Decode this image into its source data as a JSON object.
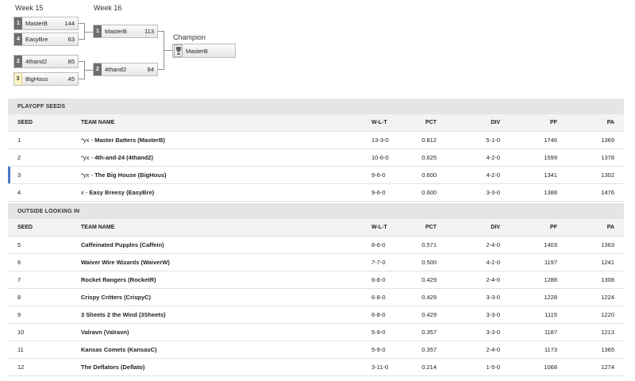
{
  "bracket": {
    "week15_label": "Week 15",
    "week16_label": "Week 16",
    "champion_label": "Champion",
    "week15": [
      {
        "seed": "1",
        "team": "MasterB",
        "score": "144",
        "highlight": false
      },
      {
        "seed": "4",
        "team": "EasyBre",
        "score": "63",
        "highlight": false
      },
      {
        "seed": "2",
        "team": "4thand2",
        "score": "85",
        "highlight": false
      },
      {
        "seed": "3",
        "team": "BigHous",
        "score": "45",
        "highlight": true
      }
    ],
    "week16": [
      {
        "seed": "1",
        "team": "MasterB",
        "score": "113"
      },
      {
        "seed": "2",
        "team": "4thand2",
        "score": "84"
      }
    ],
    "champion": {
      "team": "MasterB",
      "icon": "trophy-icon"
    }
  },
  "playoff": {
    "title": "PLAYOFF SEEDS",
    "headers": {
      "seed": "SEED",
      "team": "TEAM NAME",
      "wlt": "W-L-T",
      "pct": "PCT",
      "div": "DIV",
      "pf": "PF",
      "pa": "PA"
    },
    "rows": [
      {
        "seed": "1",
        "prefix": "*yx - ",
        "name": "Master Batters (MasterB)",
        "wlt": "13-3-0",
        "pct": "0.812",
        "div": "5-1-0",
        "pf": "1746",
        "pa": "1369"
      },
      {
        "seed": "2",
        "prefix": "*yx - ",
        "name": "4th-and-24 (4thand2)",
        "wlt": "10-6-0",
        "pct": "0.625",
        "div": "4-2-0",
        "pf": "1599",
        "pa": "1378"
      },
      {
        "seed": "3",
        "prefix": "*yx - ",
        "name": "The Big House (BigHous)",
        "wlt": "9-6-0",
        "pct": "0.600",
        "div": "4-2-0",
        "pf": "1341",
        "pa": "1302"
      },
      {
        "seed": "4",
        "prefix": "x - ",
        "name": "Easy Breesy (EasyBre)",
        "wlt": "9-6-0",
        "pct": "0.600",
        "div": "3-3-0",
        "pf": "1388",
        "pa": "1476"
      }
    ]
  },
  "outside": {
    "title": "OUTSIDE LOOKING IN",
    "headers": {
      "seed": "SEED",
      "team": "TEAM NAME",
      "wlt": "W-L-T",
      "pct": "PCT",
      "div": "DIV",
      "pf": "PF",
      "pa": "PA"
    },
    "rows": [
      {
        "seed": "5",
        "name": "Caffeinated Pupples (Caffein)",
        "wlt": "8-6-0",
        "pct": "0.571",
        "div": "2-4-0",
        "pf": "1403",
        "pa": "1363"
      },
      {
        "seed": "6",
        "name": "Waiver Wire Wizards (WaiverW)",
        "wlt": "7-7-0",
        "pct": "0.500",
        "div": "4-2-0",
        "pf": "1197",
        "pa": "1241"
      },
      {
        "seed": "7",
        "name": "Rocket Rangers (RocketR)",
        "wlt": "6-8-0",
        "pct": "0.429",
        "div": "2-4-0",
        "pf": "1288",
        "pa": "1308"
      },
      {
        "seed": "8",
        "name": "Crispy Critters (CrispyC)",
        "wlt": "6-8-0",
        "pct": "0.429",
        "div": "3-3-0",
        "pf": "1228",
        "pa": "1224"
      },
      {
        "seed": "9",
        "name": "3 Sheets 2 the Wind (3Sheets)",
        "wlt": "6-8-0",
        "pct": "0.429",
        "div": "3-3-0",
        "pf": "1115",
        "pa": "1220"
      },
      {
        "seed": "10",
        "name": "Valravn (Valravn)",
        "wlt": "5-9-0",
        "pct": "0.357",
        "div": "3-3-0",
        "pf": "1187",
        "pa": "1213"
      },
      {
        "seed": "11",
        "name": "Kansas Comets (KansasC)",
        "wlt": "5-9-0",
        "pct": "0.357",
        "div": "2-4-0",
        "pf": "1173",
        "pa": "1365"
      },
      {
        "seed": "12",
        "name": "The Deflators (Deflato)",
        "wlt": "3-11-0",
        "pct": "0.214",
        "div": "1-5-0",
        "pf": "1068",
        "pa": "1274"
      }
    ]
  },
  "colors": {
    "selected_bar": "#4a78c8",
    "seed_box": "#6e6e6e",
    "seed_highlight": "#fbf3bf"
  }
}
